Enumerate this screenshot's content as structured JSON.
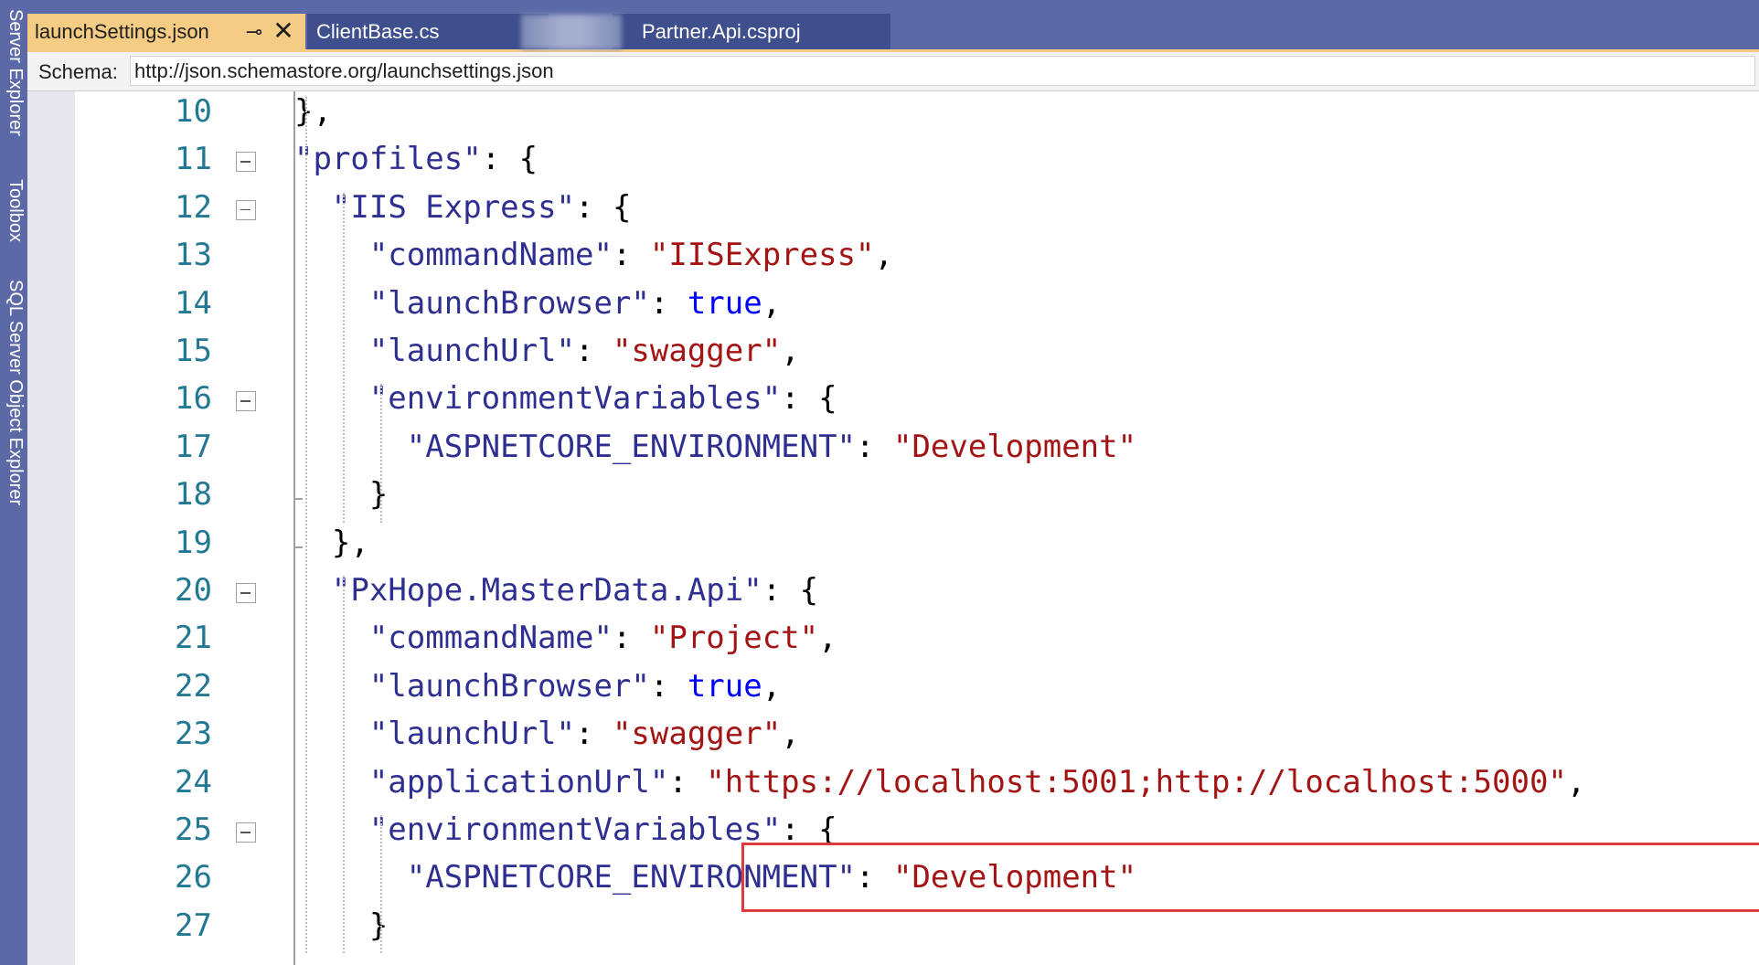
{
  "side_rail": {
    "labels": [
      "Server Explorer",
      "Toolbox",
      "SQL Server Object Explorer"
    ]
  },
  "tabs": [
    {
      "label": "launchSettings.json",
      "active": true
    },
    {
      "label": "ClientBase.cs",
      "active": false
    },
    {
      "label": "Partner.Api.csproj",
      "active": false
    }
  ],
  "tab_icons": {
    "pin": "pin-icon",
    "close": "close-icon"
  },
  "schema": {
    "label": "Schema:",
    "value": "http://json.schemastore.org/launchsettings.json"
  },
  "code": {
    "line_numbers": [
      "10",
      "11",
      "12",
      "13",
      "14",
      "15",
      "16",
      "17",
      "18",
      "19",
      "20",
      "21",
      "22",
      "23",
      "24",
      "25",
      "26",
      "27"
    ],
    "lines": [
      {
        "t": "},"
      },
      {
        "k": "\"profiles\"",
        "t": ": {"
      },
      {
        "k": "\"IIS Express\"",
        "t": ": {"
      },
      {
        "k": "\"commandName\"",
        "p": ": ",
        "s": "\"IISExpress\"",
        "e": ","
      },
      {
        "k": "\"launchBrowser\"",
        "p": ": ",
        "b": "true",
        "e": ","
      },
      {
        "k": "\"launchUrl\"",
        "p": ": ",
        "s": "\"swagger\"",
        "e": ","
      },
      {
        "k": "\"environmentVariables\"",
        "t": ": {"
      },
      {
        "k": "\"ASPNETCORE_ENVIRONMENT\"",
        "p": ": ",
        "s": "\"Development\""
      },
      {
        "t": "}"
      },
      {
        "t": "},"
      },
      {
        "k": "\"PxHope.MasterData.Api\"",
        "t": ": {"
      },
      {
        "k": "\"commandName\"",
        "p": ": ",
        "s": "\"Project\"",
        "e": ","
      },
      {
        "k": "\"launchBrowser\"",
        "p": ": ",
        "b": "true",
        "e": ","
      },
      {
        "k": "\"launchUrl\"",
        "p": ": ",
        "s": "\"swagger\"",
        "e": ","
      },
      {
        "k": "\"applicationUrl\"",
        "p": ": ",
        "s": "\"https://localhost:5001;http://localhost:5000\"",
        "e": ","
      },
      {
        "k": "\"environmentVariables\"",
        "t": ": {"
      },
      {
        "k": "\"ASPNETCORE_ENVIRONMENT\"",
        "p": ": ",
        "s": "\"Development\""
      },
      {
        "t": "}"
      }
    ]
  },
  "colors": {
    "accent_tab": "#f5cc84",
    "frame": "#5b6aa6",
    "json_key": "#2e2f90",
    "json_string": "#a31515",
    "json_bool": "#0000ff",
    "line_number": "#237893",
    "highlight_box": "#e0393e"
  }
}
